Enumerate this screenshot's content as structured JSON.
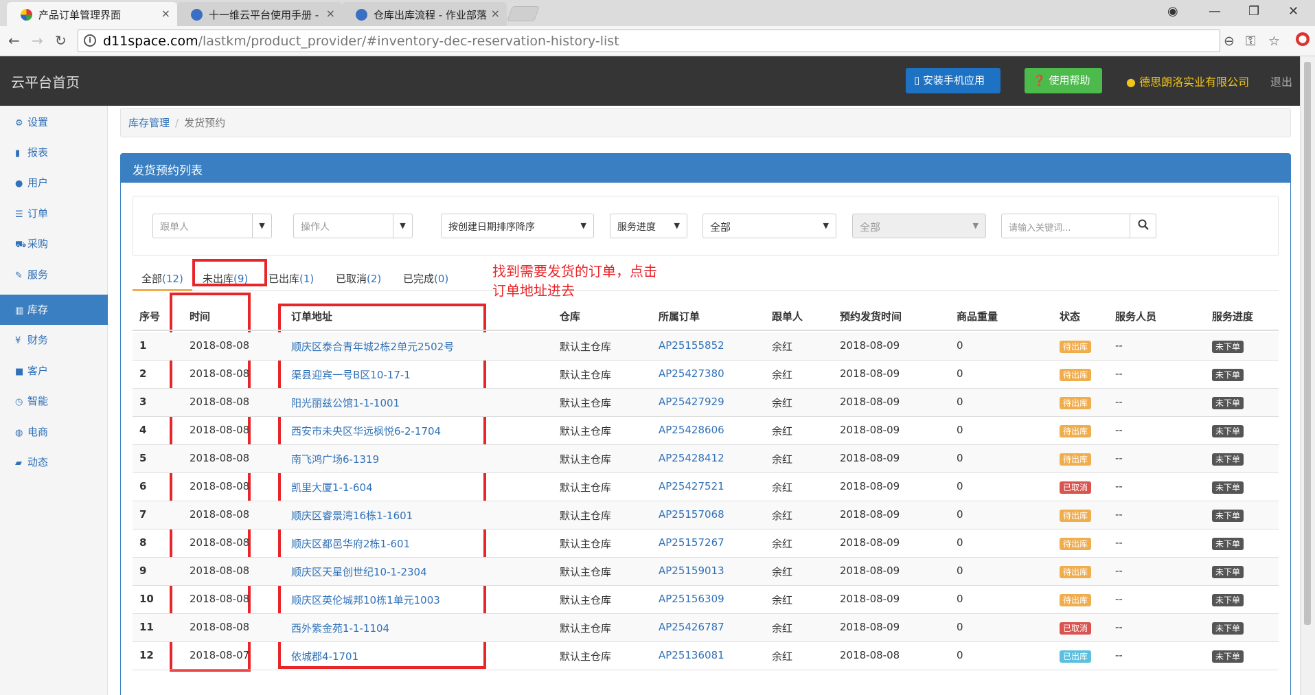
{
  "browser": {
    "tabs": [
      {
        "title": "产品订单管理界面",
        "close": "×"
      },
      {
        "title": "十一维云平台使用手册 -",
        "close": "×"
      },
      {
        "title": "仓库出库流程 - 作业部落",
        "close": "×"
      }
    ],
    "window_controls": {
      "user": "◉",
      "minimize": "—",
      "restore": "❐",
      "close": "✕"
    },
    "nav": {
      "back": "←",
      "forward": "→",
      "reload": "↻"
    },
    "url_host": "d11space.com",
    "url_path": "/lastkm/product_provider/#inventory-dec-reservation-history-list",
    "url_icons": {
      "zoom": "⊖",
      "key": "⚿",
      "star": "☆"
    }
  },
  "header": {
    "brand": "云平台首页",
    "install_app": "安装手机应用",
    "help": "使用帮助",
    "company": "德思朗洛实业有限公司",
    "logout": "退出"
  },
  "sidebar": {
    "items": [
      {
        "label": "设置",
        "icon": "⚙"
      },
      {
        "label": "报表",
        "icon": "▮"
      },
      {
        "label": "用户",
        "icon": "●"
      },
      {
        "label": "订单",
        "icon": "☰"
      },
      {
        "label": "采购",
        "icon": "⛟"
      },
      {
        "label": "服务",
        "icon": "✎"
      },
      {
        "label": "库存",
        "icon": "▥"
      },
      {
        "label": "财务",
        "icon": "¥"
      },
      {
        "label": "客户",
        "icon": "■"
      },
      {
        "label": "智能",
        "icon": "◷"
      },
      {
        "label": "电商",
        "icon": "◍"
      },
      {
        "label": "动态",
        "icon": "▰"
      }
    ],
    "active_index": 6
  },
  "breadcrumb": {
    "parent": "库存管理",
    "current": "发货预约"
  },
  "panel": {
    "title": "发货预约列表"
  },
  "filters": {
    "follower": "跟单人",
    "operator": "操作人",
    "sort": "按创建日期排序降序",
    "progress": "服务进度",
    "scope": "全部",
    "warehouse": "全部",
    "keyword_placeholder": "请输入关键词..."
  },
  "status_tabs": [
    {
      "label": "全部",
      "count": "(12)"
    },
    {
      "label": "未出库",
      "count": "(9)"
    },
    {
      "label": "已出库",
      "count": "(1)"
    },
    {
      "label": "已取消",
      "count": "(2)"
    },
    {
      "label": "已完成",
      "count": "(0)"
    }
  ],
  "annotation": {
    "line1": "找到需要发货的订单，点击",
    "line2": "订单地址进去"
  },
  "table": {
    "headers": [
      "序号",
      "时间",
      "订单地址",
      "仓库",
      "所属订单",
      "跟单人",
      "预约发货时间",
      "商品重量",
      "状态",
      "服务人员",
      "服务进度"
    ],
    "rows": [
      {
        "no": "1",
        "time": "2018-08-08",
        "address": "顺庆区泰合青年城2栋2单元2502号",
        "warehouse": "默认主仓库",
        "order": "AP25155852",
        "follower": "余红",
        "ship_time": "2018-08-09",
        "weight": "0",
        "status": "待出库",
        "status_color": "#f0ad4e",
        "staff": "--",
        "progress": "未下单"
      },
      {
        "no": "2",
        "time": "2018-08-08",
        "address": "渠县迎宾一号B区10-17-1",
        "warehouse": "默认主仓库",
        "order": "AP25427380",
        "follower": "余红",
        "ship_time": "2018-08-09",
        "weight": "0",
        "status": "待出库",
        "status_color": "#f0ad4e",
        "staff": "--",
        "progress": "未下单"
      },
      {
        "no": "3",
        "time": "2018-08-08",
        "address": "阳光丽兹公馆1-1-1001",
        "warehouse": "默认主仓库",
        "order": "AP25427929",
        "follower": "余红",
        "ship_time": "2018-08-09",
        "weight": "0",
        "status": "待出库",
        "status_color": "#f0ad4e",
        "staff": "--",
        "progress": "未下单"
      },
      {
        "no": "4",
        "time": "2018-08-08",
        "address": "西安市未央区华远枫悦6-2-1704",
        "warehouse": "默认主仓库",
        "order": "AP25428606",
        "follower": "余红",
        "ship_time": "2018-08-09",
        "weight": "0",
        "status": "待出库",
        "status_color": "#f0ad4e",
        "staff": "--",
        "progress": "未下单"
      },
      {
        "no": "5",
        "time": "2018-08-08",
        "address": "南飞鸿广场6-1319",
        "warehouse": "默认主仓库",
        "order": "AP25428412",
        "follower": "余红",
        "ship_time": "2018-08-09",
        "weight": "0",
        "status": "待出库",
        "status_color": "#f0ad4e",
        "staff": "--",
        "progress": "未下单"
      },
      {
        "no": "6",
        "time": "2018-08-08",
        "address": "凯里大厦1-1-604",
        "warehouse": "默认主仓库",
        "order": "AP25427521",
        "follower": "余红",
        "ship_time": "2018-08-09",
        "weight": "0",
        "status": "已取消",
        "status_color": "#d9534f",
        "staff": "--",
        "progress": "未下单"
      },
      {
        "no": "7",
        "time": "2018-08-08",
        "address": "顺庆区睿景湾16栋1-1601",
        "warehouse": "默认主仓库",
        "order": "AP25157068",
        "follower": "余红",
        "ship_time": "2018-08-09",
        "weight": "0",
        "status": "待出库",
        "status_color": "#f0ad4e",
        "staff": "--",
        "progress": "未下单"
      },
      {
        "no": "8",
        "time": "2018-08-08",
        "address": "顺庆区都邑华府2栋1-601",
        "warehouse": "默认主仓库",
        "order": "AP25157267",
        "follower": "余红",
        "ship_time": "2018-08-09",
        "weight": "0",
        "status": "待出库",
        "status_color": "#f0ad4e",
        "staff": "--",
        "progress": "未下单"
      },
      {
        "no": "9",
        "time": "2018-08-08",
        "address": "顺庆区天星创世纪10-1-2304",
        "warehouse": "默认主仓库",
        "order": "AP25159013",
        "follower": "余红",
        "ship_time": "2018-08-09",
        "weight": "0",
        "status": "待出库",
        "status_color": "#f0ad4e",
        "staff": "--",
        "progress": "未下单"
      },
      {
        "no": "10",
        "time": "2018-08-08",
        "address": "顺庆区英伦城邦10栋1单元1003",
        "warehouse": "默认主仓库",
        "order": "AP25156309",
        "follower": "余红",
        "ship_time": "2018-08-09",
        "weight": "0",
        "status": "待出库",
        "status_color": "#f0ad4e",
        "staff": "--",
        "progress": "未下单"
      },
      {
        "no": "11",
        "time": "2018-08-08",
        "address": "西外紫金苑1-1-1104",
        "warehouse": "默认主仓库",
        "order": "AP25426787",
        "follower": "余红",
        "ship_time": "2018-08-09",
        "weight": "0",
        "status": "已取消",
        "status_color": "#d9534f",
        "staff": "--",
        "progress": "未下单"
      },
      {
        "no": "12",
        "time": "2018-08-07",
        "address": "依城郡4-1701",
        "warehouse": "默认主仓库",
        "order": "AP25136081",
        "follower": "余红",
        "ship_time": "2018-08-08",
        "weight": "0",
        "status": "已出库",
        "status_color": "#5bc0de",
        "staff": "--",
        "progress": "未下单"
      }
    ]
  },
  "colors": {
    "primary": "#3a7fc1",
    "header_bg": "#353535",
    "annotation": "#e8262a",
    "tab_accent": "#f0ad4e"
  }
}
